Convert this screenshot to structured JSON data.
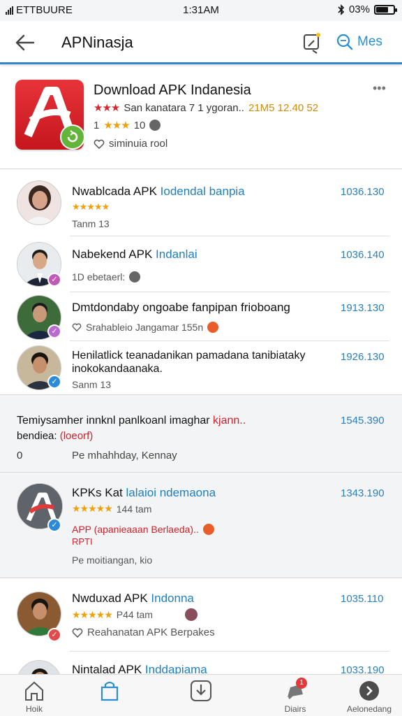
{
  "status_bar": {
    "carrier": "ETTBUURE",
    "time": "1:31AM",
    "battery": "03%",
    "battery_level": 0.7
  },
  "header": {
    "title": "APNinasja",
    "search_label": "Mes"
  },
  "featured": {
    "title": "Download APK Indanesia",
    "meta": "San kanatara 7 1 ygoran..",
    "size": "21M5 12.40 52",
    "rating_text": "1",
    "rating_count": "10",
    "tag": "siminuia rool",
    "more": "•••"
  },
  "items": [
    {
      "title_black": "Nwablcada APK",
      "title_blue": "Iodendal banpia",
      "stars": "★★★★★",
      "sub": "Tanm 13",
      "count": "1036.130",
      "verify_color": "#e34a4a"
    },
    {
      "title_black": "Nabekend APK",
      "title_blue": "Indanlai",
      "sub": "1D ebetaerl:",
      "count": "1036.140",
      "verify_color": "#c05ab6"
    },
    {
      "title_black": "Dmtdondaby ongoabe fanpipan frioboang",
      "title_blue": "",
      "sub": "Srahableio Jangamar 155n",
      "count": "1913.130",
      "verify_color": "#b96ad0"
    },
    {
      "title_black": "Henilatlick teanadanikan pamadana tanibiataky",
      "title_line2": "inokokandaanaka.",
      "sub": "Sanm 13",
      "count": "1926.130",
      "verify_color": "#2c8ad8"
    }
  ],
  "notice": {
    "line1_black": "Temiysamher innknl panlkoanl imaghar",
    "line1_red": "kjann..",
    "line2_black": "bendiea:",
    "line2_red": "(loeorf)",
    "count": "1545.390",
    "zero": "0",
    "footer": "Pe mhahhday, Kennay"
  },
  "promo": {
    "title_black": "KPKs Kat",
    "title_blue": "lalaioi ndemaona",
    "stars": "★★★★★",
    "time": "144 tam",
    "red_line1": "APP (apanieaaan Berlaeda)..",
    "red_line2": "RPTI",
    "footer": "Pe moitiangan, kio",
    "count": "1343.190"
  },
  "items2": [
    {
      "title_black": "Nwduxad APK",
      "title_blue": "Indonna",
      "stars": "★★★★★",
      "time": "P44 tam",
      "sub": "Reahanatan APK Berpakes",
      "count": "1035.110"
    },
    {
      "title_black": "Nintalad APK",
      "title_blue": "Inddapiama",
      "count": "1033.190"
    }
  ],
  "bottom_nav": [
    {
      "label": "Hoik"
    },
    {
      "label": ""
    },
    {
      "label": ""
    },
    {
      "label": "Diairs",
      "badge": "1"
    },
    {
      "label": "Aelonedang"
    }
  ],
  "colors": {
    "accent": "#2a8fd0",
    "brand_red": "#d8252c",
    "star_gold": "#f0a10a"
  }
}
